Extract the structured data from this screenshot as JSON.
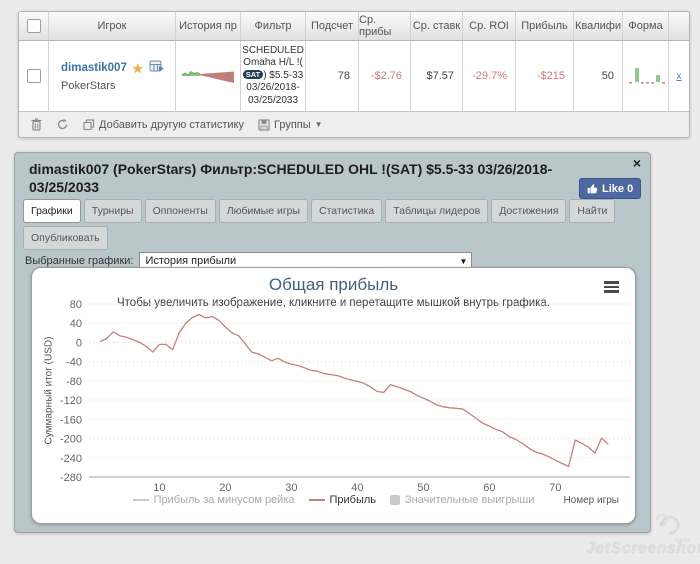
{
  "table": {
    "headers": [
      "",
      "Игрок",
      "История пр",
      "Фильтр",
      "Подсчет",
      "Ср. прибы",
      "Ср. ставк",
      "Ср. ROI",
      "Прибыль",
      "Квалифи",
      "Форма"
    ],
    "row": {
      "player": "dimastik007",
      "site": "PokerStars",
      "filter_prefix": "SCHEDULED Omaha H/L !(",
      "filter_badge": "SAT",
      "filter_suffix": ") $5.5-33 03/26/2018-03/25/2033",
      "count": "78",
      "avg_profit": "-$2.76",
      "avg_stake": "$7.57",
      "avg_roi": "-29.7%",
      "profit": "-$215",
      "qualify": "50"
    }
  },
  "toolbar": {
    "add_stat": "Добавить другую статистику",
    "groups": "Группы"
  },
  "panel": {
    "title": "dimastik007 (PokerStars) Фильтр:SCHEDULED OHL !(SAT) $5.5-33 03/26/2018-03/25/2033",
    "like_label": "Like 0",
    "tabs": [
      "Графики",
      "Турниры",
      "Оппоненты",
      "Любимые игры",
      "Статистика",
      "Таблицы лидеров",
      "Достижения",
      "Найти"
    ],
    "tabs_row2": [
      "Опубликовать"
    ],
    "active_tab": "Графики",
    "chart_select_label": "Выбранные графики:",
    "chart_select_value": "История прибыли"
  },
  "chart_data": {
    "type": "line",
    "title": "Общая прибыль",
    "subtitle": "Чтобы увеличить изображение, кликните и перетащите мышкой внутрь графика.",
    "ylabel": "Суммарный итог (USD)",
    "xlabel": "Номер игры",
    "ylim": [
      -280,
      80
    ],
    "ytick_step": 40,
    "xticks": [
      10,
      20,
      30,
      40,
      50,
      60,
      70
    ],
    "x_start": 1,
    "grid": "dotted",
    "legend_position": "bottom",
    "series": [
      {
        "name": "Прибыль",
        "color": "#c0827d",
        "values": [
          2,
          8,
          22,
          14,
          11,
          6,
          0,
          -8,
          -20,
          -4,
          -4,
          -15,
          20,
          40,
          52,
          58,
          51,
          54,
          46,
          32,
          20,
          14,
          -3,
          -20,
          -24,
          -31,
          -38,
          -33,
          -41,
          -45,
          -48,
          -53,
          -58,
          -60,
          -65,
          -67,
          -69,
          -74,
          -78,
          -81,
          -85,
          -93,
          -102,
          -104,
          -88,
          -92,
          -97,
          -102,
          -110,
          -116,
          -122,
          -130,
          -134,
          -136,
          -137,
          -139,
          -148,
          -158,
          -168,
          -174,
          -181,
          -186,
          -196,
          -202,
          -210,
          -220,
          -228,
          -232,
          -238,
          -245,
          -252,
          -258,
          -203,
          -210,
          -218,
          -230,
          -199,
          -212
        ]
      }
    ],
    "legend": [
      {
        "label": "Прибыль за минусом рейка",
        "active": false,
        "marker": "line"
      },
      {
        "label": "Прибыль",
        "active": true,
        "marker": "line"
      },
      {
        "label": "Значительные выигрыши",
        "active": false,
        "marker": "box"
      }
    ]
  },
  "icons": {
    "close": "×",
    "select_arrow": "▼",
    "groups_arrow": "▼",
    "star": "★",
    "row_close_link": "x"
  },
  "colors": {
    "link_blue": "#3d74a3",
    "negative_red": "#cc7a7a",
    "panel_bg": "#b9c7ca",
    "profit_line": "#c0827d",
    "like_blue": "#4e69a2",
    "badge_dark": "#203a54",
    "spark_green": "#8fc08a",
    "spark_red": "#c17f7c"
  },
  "watermark": {
    "text": "JetScreenshot",
    "tld": "com"
  }
}
